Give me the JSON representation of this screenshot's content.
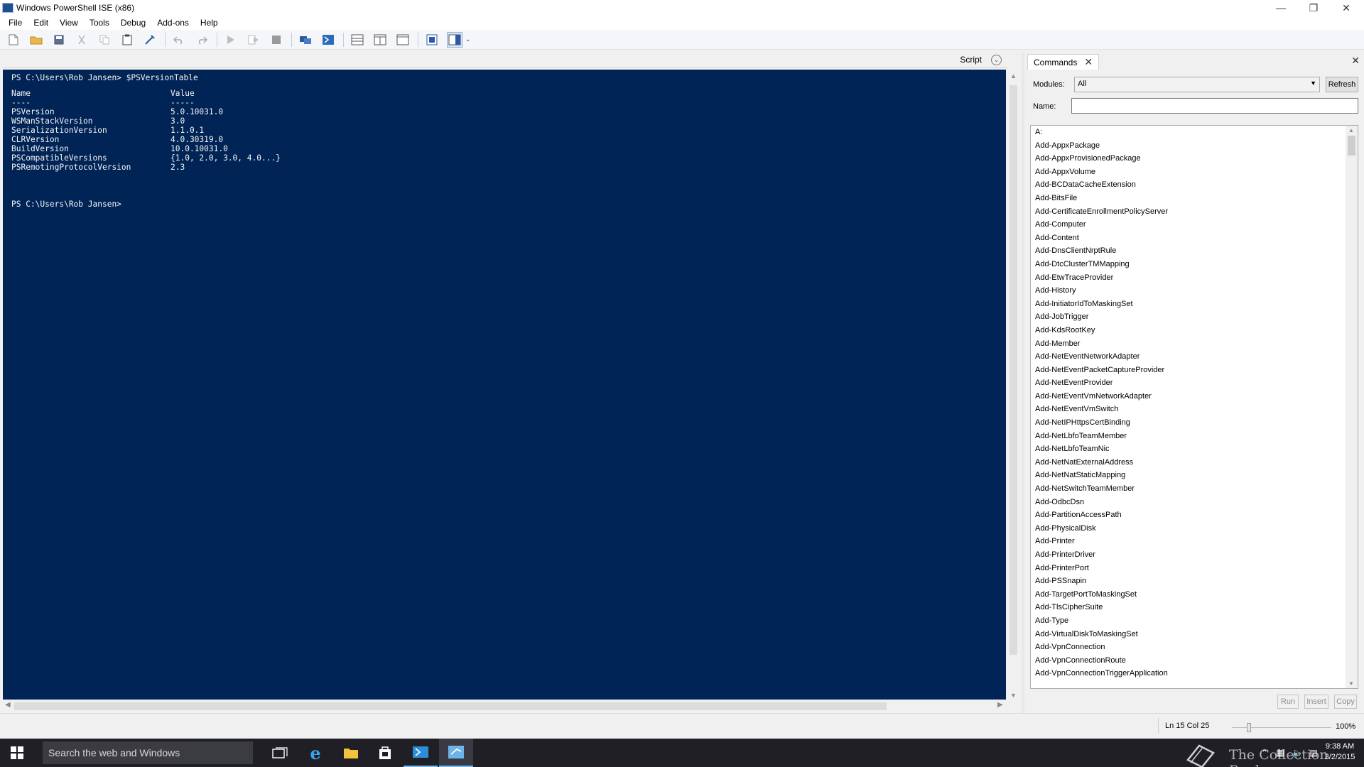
{
  "window": {
    "title": "Windows PowerShell ISE (x86)",
    "controls": [
      "—",
      "❐",
      "✕"
    ]
  },
  "menu": [
    "File",
    "Edit",
    "View",
    "Tools",
    "Debug",
    "Add-ons",
    "Help"
  ],
  "toolbar": {
    "icons": [
      "new-icon",
      "open-icon",
      "save-icon",
      "cut-icon",
      "copy-icon",
      "paste-icon",
      "clear-console-icon",
      "undo-icon",
      "redo-icon",
      "run-icon",
      "run-selection-icon",
      "stop-icon",
      "remote-powershell-icon",
      "start-powershell-icon",
      "script-pane-top-icon",
      "script-pane-right-icon",
      "script-pane-maximized-icon",
      "show-command-window-icon",
      "show-command-addon-icon"
    ]
  },
  "script_bar": {
    "label": "Script",
    "toggle": "⌄"
  },
  "console": {
    "prompt_line": "PS C:\\Users\\Rob Jansen> $PSVersionTable",
    "table": {
      "headers": [
        "Name",
        "Value"
      ],
      "underline": [
        "----",
        "-----"
      ],
      "rows": [
        [
          "PSVersion",
          "5.0.10031.0"
        ],
        [
          "WSManStackVersion",
          "3.0"
        ],
        [
          "SerializationVersion",
          "1.1.0.1"
        ],
        [
          "CLRVersion",
          "4.0.30319.0"
        ],
        [
          "BuildVersion",
          "10.0.10031.0"
        ],
        [
          "PSCompatibleVersions",
          "{1.0, 2.0, 3.0, 4.0...}"
        ],
        [
          "PSRemotingProtocolVersion",
          "2.3"
        ]
      ]
    },
    "final_prompt": "PS C:\\Users\\Rob Jansen>"
  },
  "commands_panel": {
    "tab_label": "Commands",
    "modules_label": "Modules:",
    "modules_value": "All",
    "refresh_label": "Refresh",
    "name_label": "Name:",
    "name_value": "",
    "items": [
      "A:",
      "Add-AppxPackage",
      "Add-AppxProvisionedPackage",
      "Add-AppxVolume",
      "Add-BCDataCacheExtension",
      "Add-BitsFile",
      "Add-CertificateEnrollmentPolicyServer",
      "Add-Computer",
      "Add-Content",
      "Add-DnsClientNrptRule",
      "Add-DtcClusterTMMapping",
      "Add-EtwTraceProvider",
      "Add-History",
      "Add-InitiatorIdToMaskingSet",
      "Add-JobTrigger",
      "Add-KdsRootKey",
      "Add-Member",
      "Add-NetEventNetworkAdapter",
      "Add-NetEventPacketCaptureProvider",
      "Add-NetEventProvider",
      "Add-NetEventVmNetworkAdapter",
      "Add-NetEventVmSwitch",
      "Add-NetIPHttpsCertBinding",
      "Add-NetLbfoTeamMember",
      "Add-NetLbfoTeamNic",
      "Add-NetNatExternalAddress",
      "Add-NetNatStaticMapping",
      "Add-NetSwitchTeamMember",
      "Add-OdbcDsn",
      "Add-PartitionAccessPath",
      "Add-PhysicalDisk",
      "Add-Printer",
      "Add-PrinterDriver",
      "Add-PrinterPort",
      "Add-PSSnapin",
      "Add-TargetPortToMaskingSet",
      "Add-TlsCipherSuite",
      "Add-Type",
      "Add-VirtualDiskToMaskingSet",
      "Add-VpnConnection",
      "Add-VpnConnectionRoute",
      "Add-VpnConnectionTriggerApplication"
    ],
    "run_label": "Run",
    "insert_label": "Insert",
    "copy_label": "Copy"
  },
  "status": {
    "position": "Ln 15  Col 25",
    "zoom": "100%",
    "zoom_fraction": 0.17
  },
  "taskbar": {
    "search_placeholder": "Search the web and Windows",
    "watermark": "The Collection Book",
    "time": "9:38 AM",
    "date": "3/2/2015"
  },
  "colors": {
    "console_bg": "#012456",
    "console_fg": "#f5f5f5",
    "taskbar_bg": "#1f1f25",
    "accent": "#76b9ed"
  }
}
